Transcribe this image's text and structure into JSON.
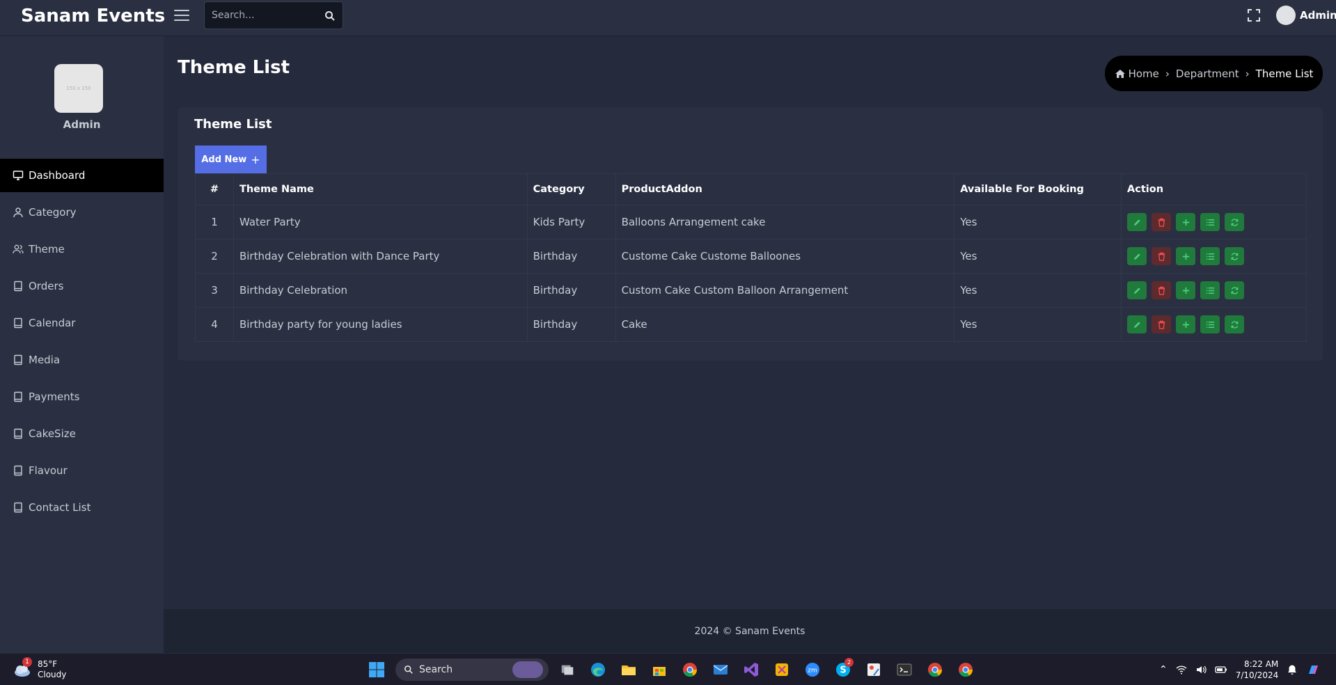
{
  "app": {
    "brand": "Sanam Events",
    "user": "Admin"
  },
  "search": {
    "placeholder": "Search..."
  },
  "sidebar": {
    "profile_image_text": "150 x 150",
    "profile_name": "Admin",
    "items": [
      {
        "label": "Dashboard",
        "icon": "monitor-icon",
        "active": true
      },
      {
        "label": "Category",
        "icon": "user-icon"
      },
      {
        "label": "Theme",
        "icon": "users-icon"
      },
      {
        "label": "Orders",
        "icon": "book-icon"
      },
      {
        "label": "Calendar",
        "icon": "book-icon"
      },
      {
        "label": "Media",
        "icon": "book-icon"
      },
      {
        "label": "Payments",
        "icon": "book-icon"
      },
      {
        "label": "CakeSize",
        "icon": "book-icon"
      },
      {
        "label": "Flavour",
        "icon": "book-icon"
      },
      {
        "label": "Contact List",
        "icon": "book-icon"
      }
    ]
  },
  "page": {
    "title": "Theme List"
  },
  "breadcrumb": {
    "home": "Home",
    "section": "Department",
    "current": "Theme List"
  },
  "card": {
    "title": "Theme List",
    "add_button": "Add New"
  },
  "table": {
    "headers": [
      "#",
      "Theme Name",
      "Category",
      "ProductAddon",
      "Available For Booking",
      "Action"
    ],
    "rows": [
      [
        "1",
        "Water Party",
        "Kids Party",
        "Balloons Arrangement cake",
        "Yes"
      ],
      [
        "2",
        "Birthday Celebration with Dance Party",
        "Birthday",
        "Custome Cake Custome Balloones",
        "Yes"
      ],
      [
        "3",
        "Birthday Celebration",
        "Birthday",
        "Custom Cake Custom Balloon Arrangement",
        "Yes"
      ],
      [
        "4",
        "Birthday party for young ladies",
        "Birthday",
        "Cake",
        "Yes"
      ]
    ],
    "row_actions": [
      "edit",
      "delete",
      "add",
      "list",
      "refresh"
    ]
  },
  "footer": {
    "text": "2024 © Sanam Events"
  },
  "taskbar": {
    "weather": {
      "temp": "85°F",
      "condition": "Cloudy",
      "badge": "1"
    },
    "search_label": "Search",
    "skype_badge": "2",
    "time": "8:22 AM",
    "date": "7/10/2024"
  },
  "colors": {
    "accent": "#556ee6",
    "success": "#1f7a3c",
    "danger": "#5d2a2e",
    "surface": "#2a3042",
    "background": "#252b3c"
  }
}
